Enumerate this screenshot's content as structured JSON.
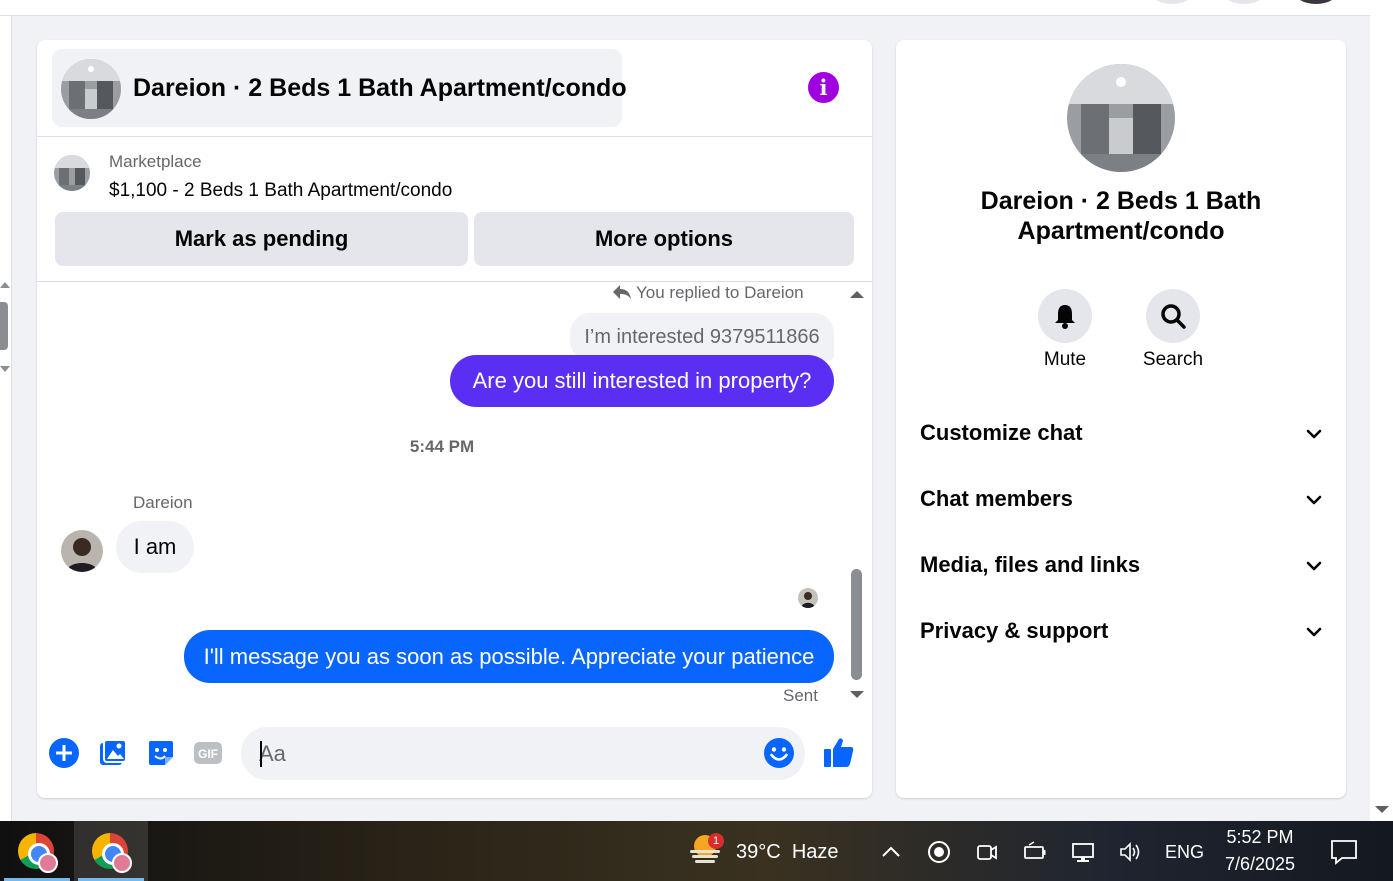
{
  "chat": {
    "title": "Dareion · 2 Beds 1 Bath Apartment/condo",
    "listing": {
      "source": "Marketplace",
      "title": "$1,100 - 2 Beds 1 Bath Apartment/condo"
    },
    "buttons": {
      "mark_pending": "Mark as pending",
      "more_options": "More options"
    },
    "messages": {
      "replied_label": "You replied to Dareion",
      "quoted_message": "I’m interested 9379511866",
      "outgoing_1": "Are you still interested in property?",
      "timestamp": "5:44 PM",
      "sender_name": "Dareion",
      "incoming_1": "I am",
      "outgoing_2": "I'll message you as soon as possible. Appreciate your patience",
      "status": "Sent"
    },
    "composer": {
      "placeholder": "Aa"
    }
  },
  "info_panel": {
    "title": "Dareion · 2 Beds 1 Bath Apartment/condo",
    "actions": [
      {
        "label": "Mute",
        "icon": "bell-icon"
      },
      {
        "label": "Search",
        "icon": "search-icon"
      }
    ],
    "sections": [
      {
        "label": "Customize chat"
      },
      {
        "label": "Chat members"
      },
      {
        "label": "Media, files and links"
      },
      {
        "label": "Privacy & support"
      }
    ]
  },
  "taskbar": {
    "weather": {
      "temp": "39°C",
      "condition": "Haze",
      "badge": "1"
    },
    "language": "ENG",
    "time": "5:52 PM",
    "date": "7/6/2025"
  },
  "colors": {
    "accent_purple": "#5b2ff3",
    "accent_blue": "#0866ff",
    "info_purple": "#a000e0",
    "icon_blue": "#0866ff"
  }
}
